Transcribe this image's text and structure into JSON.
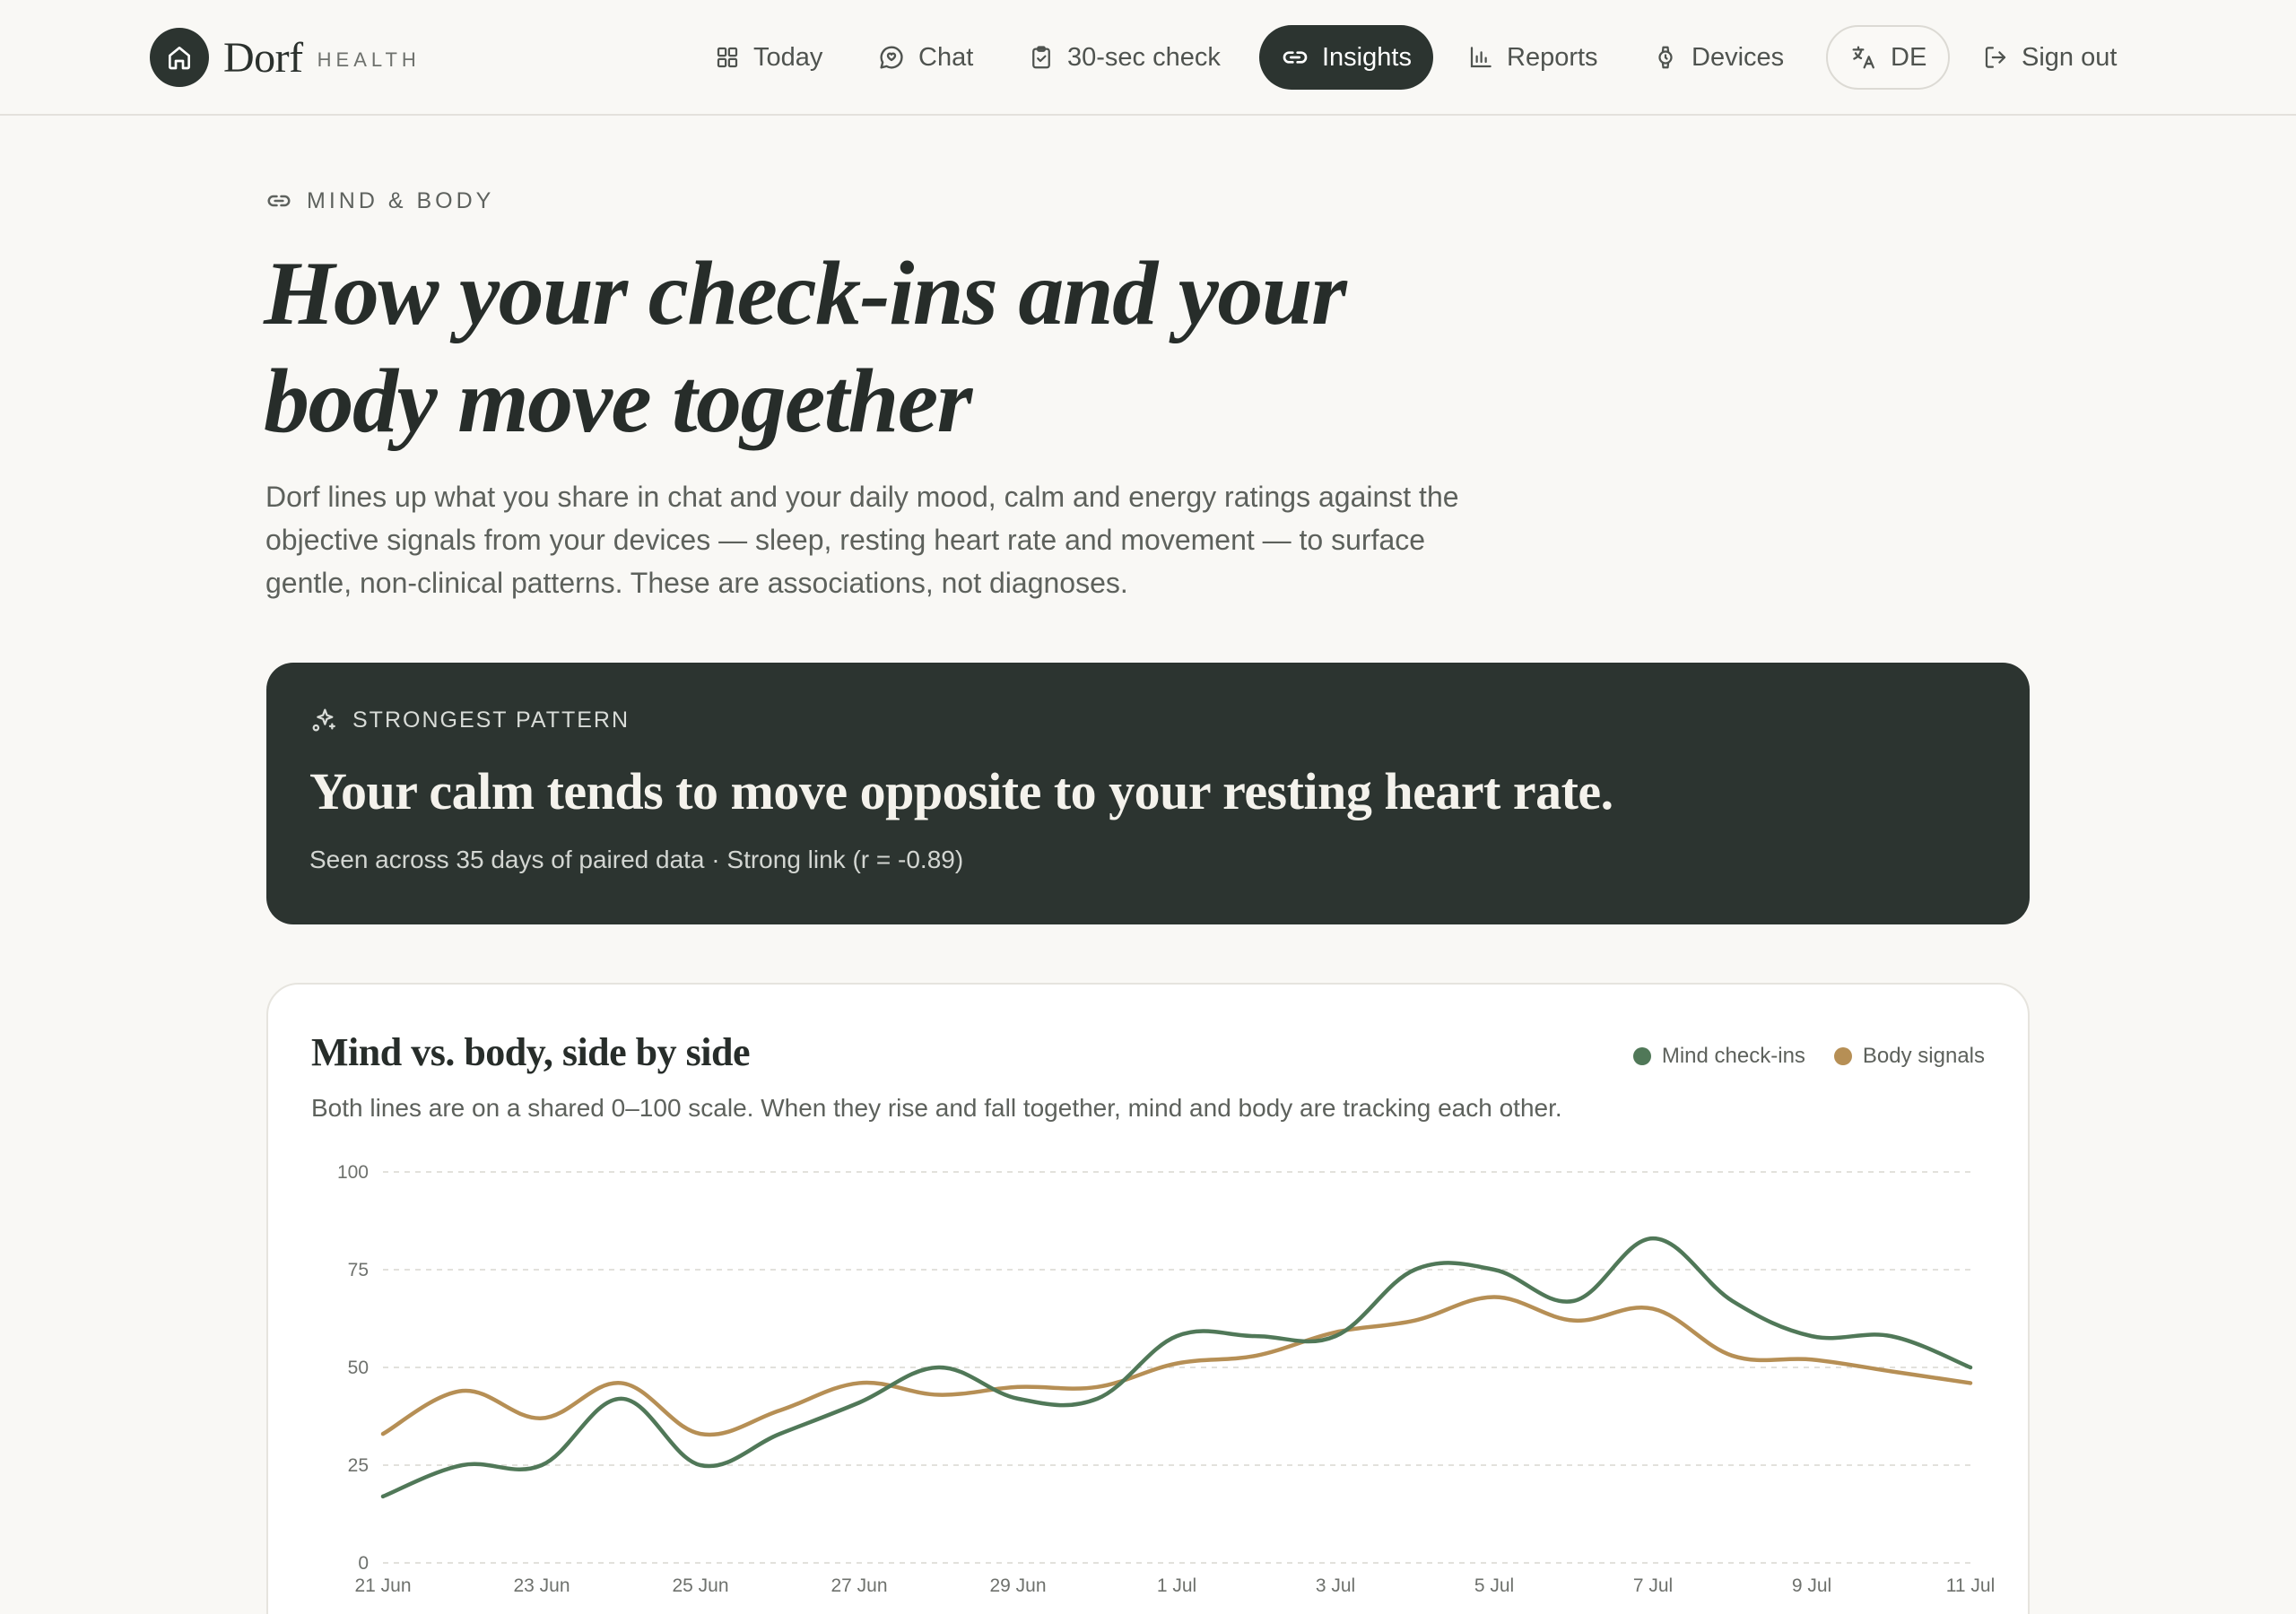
{
  "brand": {
    "name": "Dorf",
    "sub": "HEALTH"
  },
  "nav": [
    {
      "id": "today",
      "label": "Today",
      "icon": "grid-icon"
    },
    {
      "id": "chat",
      "label": "Chat",
      "icon": "chat-bubble-icon"
    },
    {
      "id": "check",
      "label": "30-sec check",
      "icon": "clipboard-check-icon"
    },
    {
      "id": "insights",
      "label": "Insights",
      "icon": "link-icon",
      "active": true
    },
    {
      "id": "reports",
      "label": "Reports",
      "icon": "bar-chart-icon"
    },
    {
      "id": "devices",
      "label": "Devices",
      "icon": "watch-icon"
    },
    {
      "id": "language",
      "label": "DE",
      "icon": "translate-icon"
    },
    {
      "id": "signout",
      "label": "Sign out",
      "icon": "sign-out-icon"
    }
  ],
  "hero": {
    "eyebrow": "MIND & BODY",
    "headline": "How your check-ins and your body move together",
    "lede": "Dorf lines up what you share in chat and your daily mood, calm and energy ratings against the objective signals from your devices — sleep, resting heart rate and movement — to surface gentle, non-clinical patterns. These are associations, not diagnoses."
  },
  "pattern": {
    "eyebrow": "STRONGEST PATTERN",
    "title": "Your calm tends to move opposite to your resting heart rate.",
    "meta": "Seen across 35 days of paired data · Strong link (r = -0.89)"
  },
  "chart_card": {
    "title": "Mind vs. body, side by side",
    "subtitle": "Both lines are on a shared 0–100 scale. When they rise and fall together, mind and body are tracking each other.",
    "legend": [
      {
        "label": "Mind check-ins",
        "color": "#507858"
      },
      {
        "label": "Body signals",
        "color": "#b68f55"
      }
    ]
  },
  "colors": {
    "dark": "#2c3430",
    "mind": "#507858",
    "body": "#b68f55",
    "background": "#f9f8f5"
  },
  "chart_data": {
    "type": "line",
    "x": [
      "21 Jun",
      "22 Jun",
      "23 Jun",
      "24 Jun",
      "25 Jun",
      "26 Jun",
      "27 Jun",
      "28 Jun",
      "29 Jun",
      "30 Jun",
      "1 Jul",
      "2 Jul",
      "3 Jul",
      "4 Jul",
      "5 Jul",
      "6 Jul",
      "7 Jul",
      "8 Jul",
      "9 Jul",
      "10 Jul",
      "11 Jul"
    ],
    "x_ticks": [
      "21 Jun",
      "23 Jun",
      "25 Jun",
      "27 Jun",
      "29 Jun",
      "1 Jul",
      "3 Jul",
      "5 Jul",
      "7 Jul",
      "9 Jul",
      "11 Jul"
    ],
    "series": [
      {
        "name": "Mind check-ins",
        "color": "#507858",
        "values": [
          17,
          25,
          25,
          42,
          25,
          33,
          41,
          50,
          42,
          42,
          58,
          58,
          58,
          75,
          75,
          67,
          83,
          67,
          58,
          58,
          50
        ]
      },
      {
        "name": "Body signals",
        "color": "#b68f55",
        "values": [
          33,
          44,
          37,
          46,
          33,
          39,
          46,
          43,
          45,
          45,
          51,
          53,
          59,
          62,
          68,
          62,
          65,
          53,
          52,
          49,
          46
        ]
      }
    ],
    "ylim": [
      0,
      100
    ],
    "y_ticks": [
      0,
      25,
      50,
      75,
      100
    ],
    "grid": true,
    "legend_position": "top-right"
  }
}
